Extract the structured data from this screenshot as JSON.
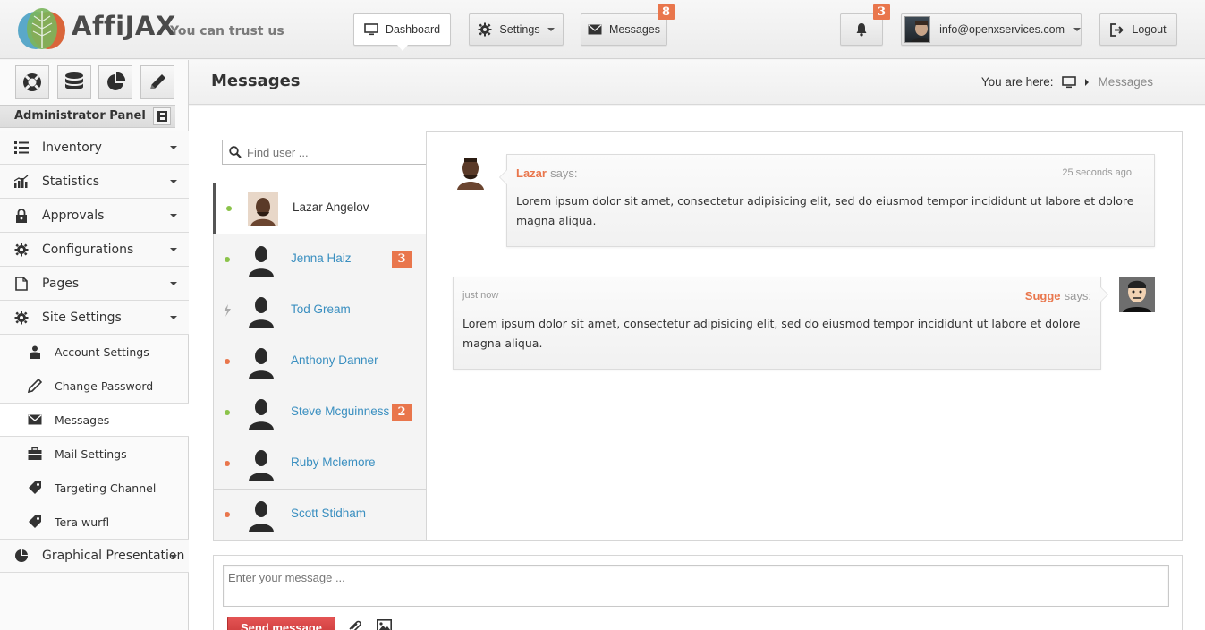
{
  "brand": {
    "name": "AffiJAX",
    "tagline": "You can trust us"
  },
  "topnav": {
    "dashboard_label": "Dashboard",
    "settings_label": "Settings",
    "messages_label": "Messages",
    "messages_badge": "8",
    "notifications_badge": "3",
    "user_email": "info@openxservices.com",
    "logout_label": "Logout"
  },
  "sidebar": {
    "panel_title": "Administrator Panel",
    "items": [
      {
        "label": "Inventory",
        "icon": "list-icon"
      },
      {
        "label": "Statistics",
        "icon": "bar-chart-icon"
      },
      {
        "label": "Approvals",
        "icon": "lock-icon"
      },
      {
        "label": "Configurations",
        "icon": "gear-icon"
      },
      {
        "label": "Pages",
        "icon": "document-icon"
      },
      {
        "label": "Site Settings",
        "icon": "gear-icon"
      }
    ],
    "subitems": [
      {
        "label": "Account Settings",
        "icon": "user-icon"
      },
      {
        "label": "Change Password",
        "icon": "pencil-icon"
      },
      {
        "label": "Messages",
        "icon": "envelope-icon"
      },
      {
        "label": "Mail Settings",
        "icon": "briefcase-icon"
      },
      {
        "label": "Targeting Channel",
        "icon": "tag-icon"
      },
      {
        "label": "Tera wurfl",
        "icon": "tag-icon"
      }
    ],
    "bottom_item": {
      "label": "Graphical Presentation",
      "icon": "pie-chart-icon"
    }
  },
  "page": {
    "title": "Messages",
    "breadcrumb_prefix": "You are here:",
    "breadcrumb_current": "Messages"
  },
  "users": {
    "search_placeholder": "Find user ...",
    "list": [
      {
        "name": "Lazar Angelov",
        "status": "online",
        "status_color": "#8bc34a",
        "badge": ""
      },
      {
        "name": "Jenna Haiz",
        "status": "online",
        "status_color": "#8bc34a",
        "badge": "3"
      },
      {
        "name": "Tod Gream",
        "status": "away",
        "status_color": "#aaaaaa",
        "badge": ""
      },
      {
        "name": "Anthony Danner",
        "status": "busy",
        "status_color": "#e9764c",
        "badge": ""
      },
      {
        "name": "Steve Mcguinness",
        "status": "online",
        "status_color": "#8bc34a",
        "badge": "2"
      },
      {
        "name": "Ruby Mclemore",
        "status": "busy",
        "status_color": "#e9764c",
        "badge": ""
      },
      {
        "name": "Scott Stidham",
        "status": "busy",
        "status_color": "#e9764c",
        "badge": ""
      }
    ]
  },
  "chat": {
    "messages": [
      {
        "author": "Lazar",
        "says": "says:",
        "time": "25 seconds ago",
        "text": "Lorem ipsum dolor sit amet, consectetur adipisicing elit, sed do eiusmod tempor incididunt ut labore et dolore magna aliqua."
      },
      {
        "author": "Sugge",
        "says": "says:",
        "time": "just now",
        "text": "Lorem ipsum dolor sit amet, consectetur adipisicing elit, sed do eiusmod tempor incididunt ut labore et dolore magna aliqua."
      }
    ]
  },
  "composer": {
    "placeholder": "Enter your message ...",
    "send_label": "Send message"
  },
  "colors": {
    "accent": "#e9764c",
    "link": "#3a8fc0",
    "send_button": "#d64141"
  }
}
